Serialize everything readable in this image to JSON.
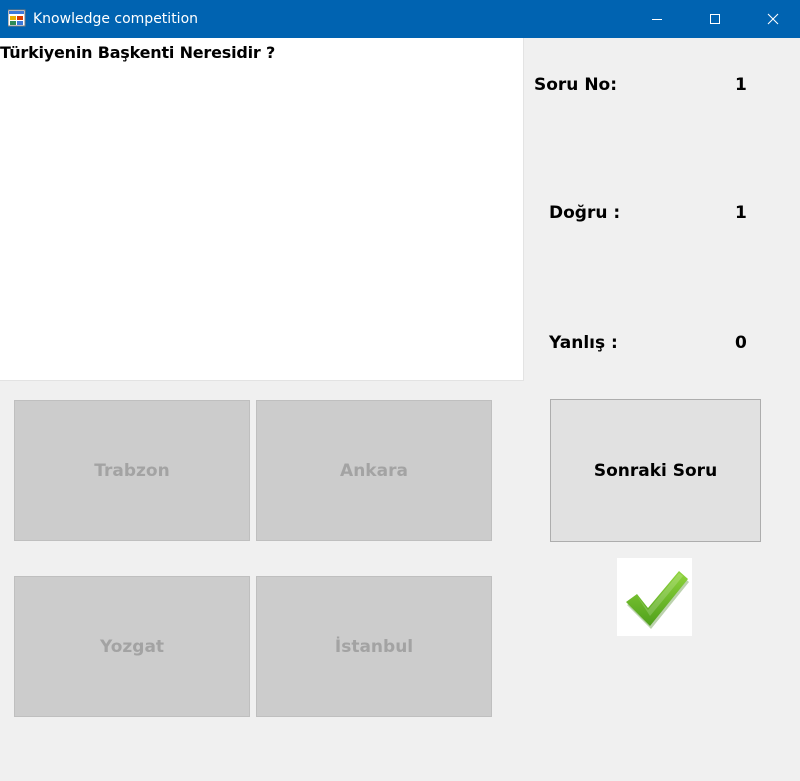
{
  "window": {
    "title": "Knowledge competition",
    "icon": "winforms-app-icon",
    "controls": [
      "minimize-icon",
      "maximize-icon",
      "close-icon"
    ]
  },
  "question": {
    "text": "Türkiyenin Başkenti Neresidir ?"
  },
  "stats": {
    "soru_label": "Soru No:",
    "soru_value": "1",
    "dogru_label": "Doğru :",
    "dogru_value": "1",
    "yanlis_label": "Yanlış :",
    "yanlis_value": "0"
  },
  "answers": [
    {
      "label": "Trabzon",
      "enabled": false
    },
    {
      "label": "Ankara",
      "enabled": false
    },
    {
      "label": "Yozgat",
      "enabled": false
    },
    {
      "label": "İstanbul",
      "enabled": false
    }
  ],
  "next_button": {
    "label": "Sonraki Soru"
  },
  "result_icon": "green-checkmark-icon",
  "colors": {
    "titlebar": "#0063b1",
    "disabled_button": "#cccccc",
    "disabled_text": "#a3a3a3",
    "check_green": "#6cc024"
  }
}
